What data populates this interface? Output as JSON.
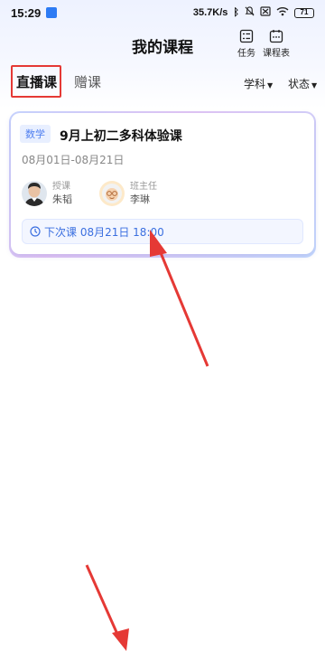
{
  "status": {
    "time": "15:29",
    "net_speed": "35.7K/s",
    "battery": "71"
  },
  "header": {
    "title": "我的课程",
    "task_label": "任务",
    "schedule_label": "课程表"
  },
  "tabs": {
    "live": "直播课",
    "gift": "赠课",
    "filter_subject": "学科",
    "filter_status": "状态"
  },
  "course": {
    "subject": "数学",
    "title": "9月上初二多科体验课",
    "dates": "08月01日-08月21日",
    "teacher_role": "授课",
    "teacher_name": "朱韬",
    "head_teacher_role": "班主任",
    "head_teacher_name": "李琳",
    "next_class": "下次课 08月21日 18:00"
  },
  "colors": {
    "accent": "#3b6fe0",
    "annotation": "#e53935"
  }
}
